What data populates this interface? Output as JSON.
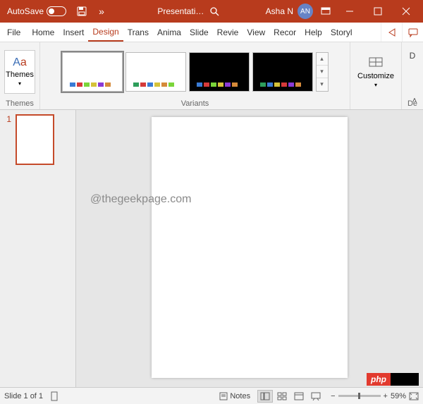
{
  "titlebar": {
    "autosave_label": "AutoSave",
    "doc_title": "Presentati…",
    "user_name": "Asha N",
    "user_initials": "AN"
  },
  "tabs": {
    "file": "File",
    "home": "Home",
    "insert": "Insert",
    "design": "Design",
    "transitions": "Trans",
    "animations": "Anima",
    "slideshow": "Slide",
    "review": "Revie",
    "view": "View",
    "recording": "Recor",
    "help": "Help",
    "storyboard": "Storyl"
  },
  "ribbon": {
    "themes_btn": "Themes",
    "themes_label": "Themes",
    "variants_label": "Variants",
    "customize_btn": "Customize",
    "design_group_initial": "D",
    "design_group_label": "De"
  },
  "variants": [
    {
      "bg": "light",
      "swatches": [
        "#3a7bd5",
        "#d53a3a",
        "#7bd53a",
        "#d5c23a",
        "#8a3ad5",
        "#d58a3a"
      ],
      "selected": true
    },
    {
      "bg": "light",
      "swatches": [
        "#2e9e5b",
        "#d53a3a",
        "#3a7bd5",
        "#d5c23a",
        "#d58a3a",
        "#7bd53a"
      ],
      "selected": false
    },
    {
      "bg": "dark",
      "swatches": [
        "#3a7bd5",
        "#d53a3a",
        "#7bd53a",
        "#d5c23a",
        "#8a3ad5",
        "#d58a3a"
      ],
      "selected": false
    },
    {
      "bg": "dark",
      "swatches": [
        "#2e9e5b",
        "#3a7bd5",
        "#d5c23a",
        "#d53a3a",
        "#8a3ad5",
        "#d58a3a"
      ],
      "selected": false
    }
  ],
  "thumbnails": [
    {
      "num": "1"
    }
  ],
  "watermark": "@thegeekpage.com",
  "badge": {
    "php": "php"
  },
  "status": {
    "slide_counter": "Slide 1 of 1",
    "notes_label": "Notes",
    "zoom_pct": "59%"
  }
}
